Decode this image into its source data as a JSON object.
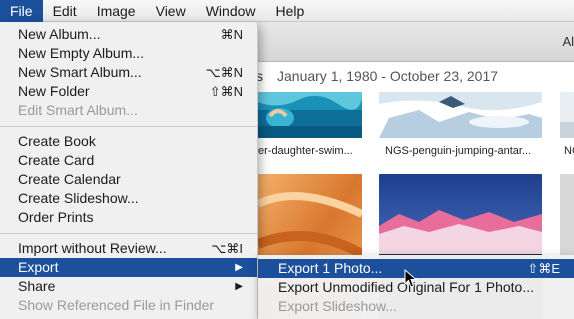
{
  "menubar": {
    "items": [
      {
        "label": "File",
        "active": true
      },
      {
        "label": "Edit"
      },
      {
        "label": "Image"
      },
      {
        "label": "View"
      },
      {
        "label": "Window"
      },
      {
        "label": "Help"
      }
    ]
  },
  "toolbar": {
    "right_text": "Al"
  },
  "content": {
    "title_suffix": "s",
    "date_range": "January 1, 1980 - October 23, 2017",
    "photos": [
      {
        "caption": "er-daughter-swim..."
      },
      {
        "caption": "NGS-penguin-jumping-antar..."
      },
      {
        "caption": "NG"
      }
    ]
  },
  "file_menu": {
    "items": [
      {
        "label": "New Album...",
        "shortcut": "⌘N"
      },
      {
        "label": "New Empty Album..."
      },
      {
        "label": "New Smart Album...",
        "shortcut": "⌥⌘N"
      },
      {
        "label": "New Folder",
        "shortcut": "⇧⌘N"
      },
      {
        "label": "Edit Smart Album...",
        "disabled": true
      },
      {
        "label": "Create Book"
      },
      {
        "label": "Create Card"
      },
      {
        "label": "Create Calendar"
      },
      {
        "label": "Create Slideshow..."
      },
      {
        "label": "Order Prints"
      },
      {
        "label": "Import without Review...",
        "shortcut": "⌥⌘I"
      },
      {
        "label": "Export",
        "highlight": true,
        "submenu": true
      },
      {
        "label": "Share",
        "submenu": true
      },
      {
        "label": "Show Referenced File in Finder",
        "disabled": true
      }
    ]
  },
  "export_submenu": {
    "items": [
      {
        "label": "Export 1 Photo...",
        "shortcut": "⇧⌘E",
        "highlight": true
      },
      {
        "label": "Export Unmodified Original For 1 Photo..."
      },
      {
        "label": "Export Slideshow...",
        "disabled": true
      }
    ]
  },
  "colors": {
    "highlight": "#1c4f9c"
  }
}
